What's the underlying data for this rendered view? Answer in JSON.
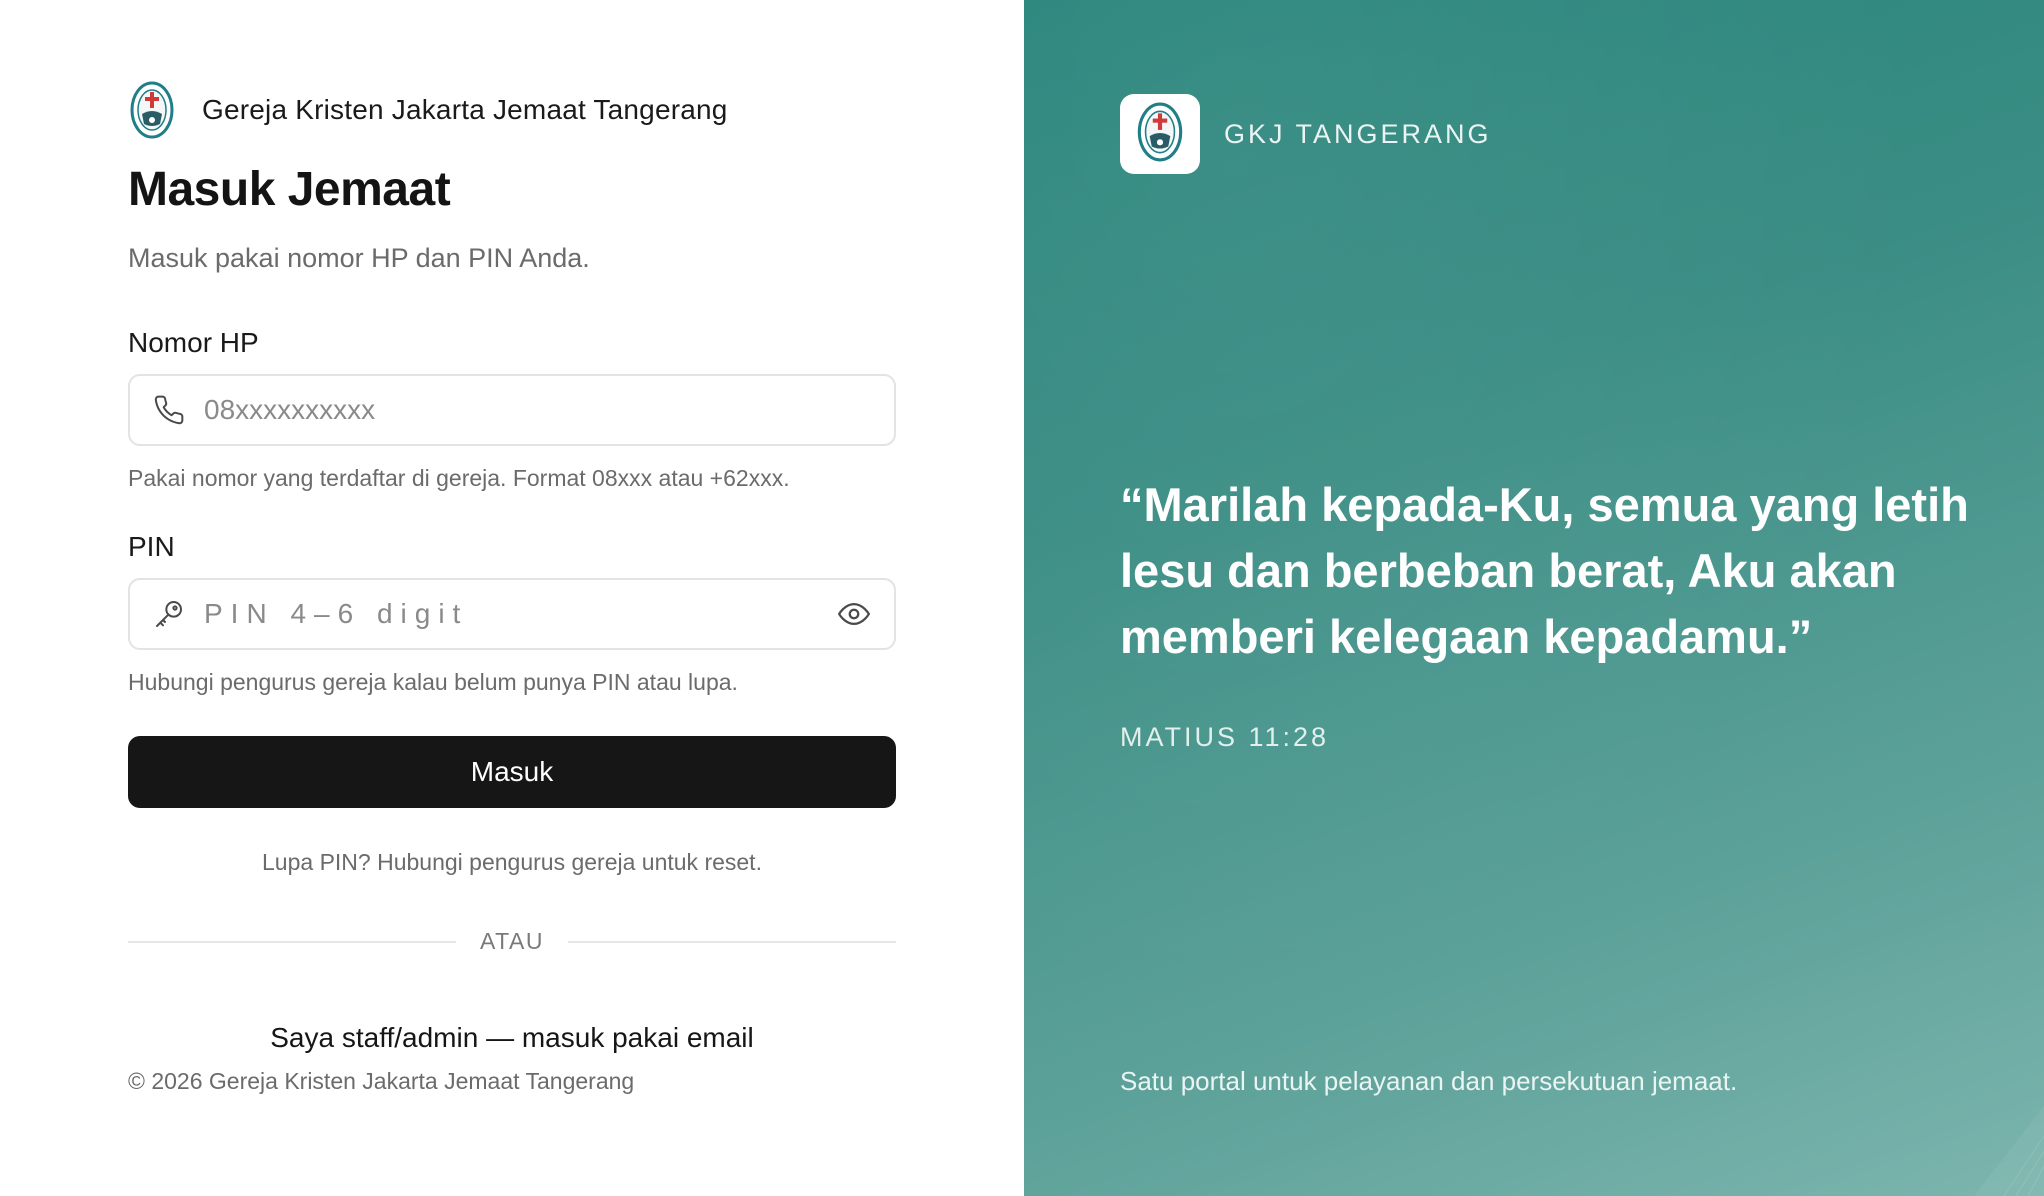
{
  "colors": {
    "panel_teal": "#2d8a80",
    "button_dark": "#161616",
    "logo_red": "#d13a3a",
    "logo_teal": "#1f7e86"
  },
  "brand": {
    "name": "Gereja Kristen Jakarta Jemaat Tangerang",
    "logo_icon": "church-seal-icon"
  },
  "login": {
    "title": "Masuk Jemaat",
    "subtitle": "Masuk pakai nomor HP dan PIN Anda.",
    "phone": {
      "label": "Nomor HP",
      "placeholder": "08xxxxxxxxxx",
      "value": "",
      "icon": "phone-icon",
      "hint": "Pakai nomor yang terdaftar di gereja. Format 08xxx atau +62xxx."
    },
    "pin": {
      "label": "PIN",
      "placeholder": "PIN 4–6 digit",
      "value": "",
      "icon": "key-icon",
      "toggle_icon": "eye-icon",
      "hint": "Hubungi pengurus gereja kalau belum punya PIN atau lupa."
    },
    "submit_label": "Masuk",
    "forgot_text": "Lupa PIN? Hubungi pengurus gereja untuk reset.",
    "divider_text": "ATAU",
    "staff_link": "Saya staff/admin — masuk pakai email",
    "copyright": "© 2026 Gereja Kristen Jakarta Jemaat Tangerang"
  },
  "panel": {
    "brand_name": "GKJ TANGERANG",
    "quote": "“Marilah kepada-Ku, semua yang letih lesu dan berbeban berat, Aku akan memberi kelegaan kepadamu.”",
    "reference": "MATIUS 11:28",
    "tagline": "Satu portal untuk pelayanan dan persekutuan jemaat."
  }
}
